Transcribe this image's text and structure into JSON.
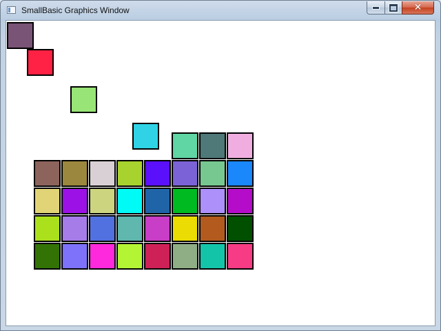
{
  "window": {
    "title": "SmallBasic Graphics Window",
    "icon": "app-window-icon",
    "buttons": {
      "minimize": {
        "icon": "minimize-icon"
      },
      "maximize": {
        "icon": "maximize-icon"
      },
      "close": {
        "icon": "close-icon",
        "glyph": "✕"
      }
    }
  },
  "canvas": {
    "background": "#ffffff",
    "stray_squares": [
      {
        "color": "#7a5476"
      },
      {
        "color": "#ff2244"
      },
      {
        "color": "#98e477"
      },
      {
        "color": "#30d3e6"
      }
    ],
    "top_row": [
      "#5fd6a4",
      "#4f7878",
      "#f0aee0"
    ],
    "grid_rows": [
      [
        "#8c645c",
        "#9b873d",
        "#d8d0d4",
        "#a8d22e",
        "#5b10fb",
        "#7b62d6",
        "#77c890",
        "#1a87fb"
      ],
      [
        "#e1d477",
        "#9c12e6",
        "#ccd47f",
        "#00fbf6",
        "#2064a8",
        "#00ba22",
        "#ad90fa",
        "#b40cc8"
      ],
      [
        "#abe11c",
        "#a67ce8",
        "#5271e1",
        "#5fb7ae",
        "#c93ec6",
        "#ebdc04",
        "#b35b1e",
        "#005000"
      ],
      [
        "#337306",
        "#7e72fa",
        "#fe29dc",
        "#b3f534",
        "#cd2158",
        "#90ae86",
        "#14c4a8",
        "#f73b84"
      ]
    ]
  }
}
